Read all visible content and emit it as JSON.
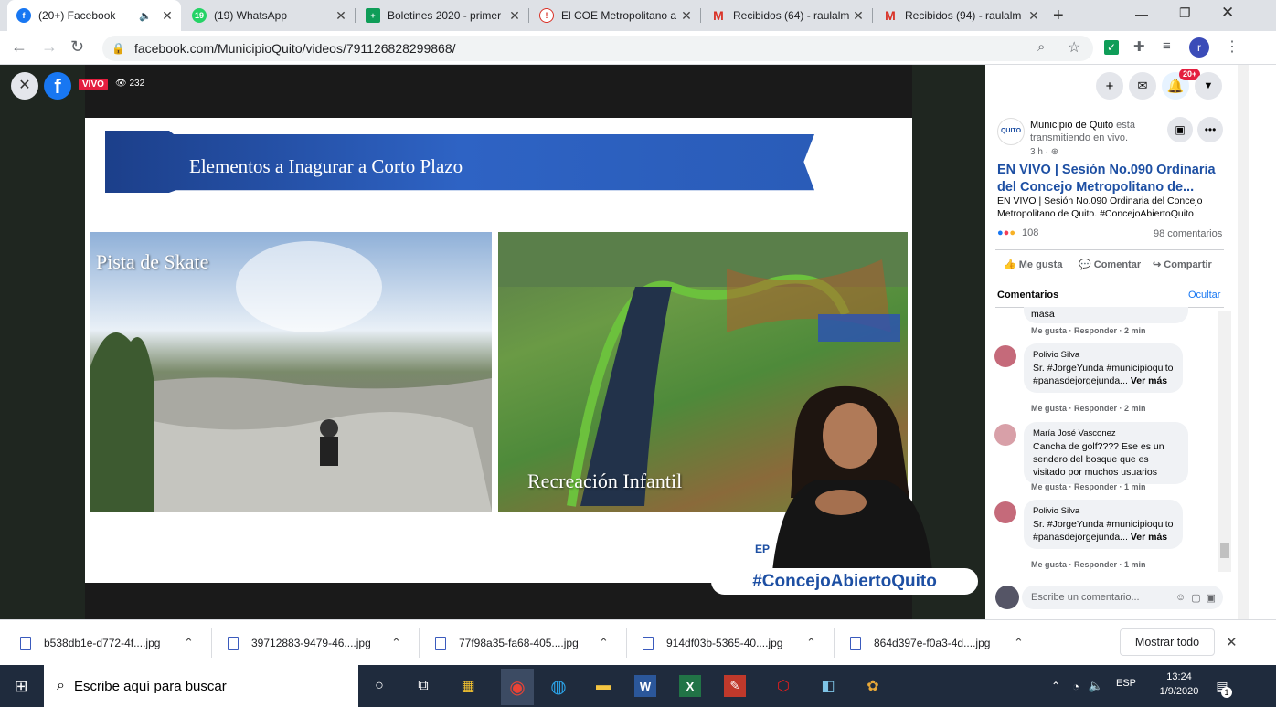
{
  "tabs": [
    {
      "title": "(20+) Facebook",
      "active": true
    },
    {
      "title": "(19) WhatsApp",
      "badge": "19"
    },
    {
      "title": "Boletines 2020 - primer"
    },
    {
      "title": "El COE Metropolitano a"
    },
    {
      "title": "Recibidos (64) - raulalm"
    },
    {
      "title": "Recibidos (94) - raulalm"
    }
  ],
  "address": {
    "url": "facebook.com/MunicipioQuito/videos/791126828299868/"
  },
  "video": {
    "live_label": "VIVO",
    "viewers": "232",
    "slide_title": "Elementos a Inagurar a Corto Plazo",
    "caption_left": "Pista de Skate",
    "caption_right": "Recreación Infantil",
    "hashtag": "#ConcejoAbiertoQuito",
    "corner_logo": "EP"
  },
  "panel": {
    "notif_badge": "20+",
    "page_logo": "QUITO",
    "page_name": "Municipio de Quito",
    "status_text": " está transmitiendo en vivo.",
    "time": "3 h",
    "post_title": "EN VIVO | Sesión No.090 Ordinaria del Concejo Metropolitano de...",
    "post_desc": "EN VIVO | Sesión No.090 Ordinaria del Concejo Metropolitano de Quito. #ConcejoAbiertoQuito",
    "reactions": "108",
    "comments_count": "98 comentarios",
    "like": "Me gusta",
    "comment": "Comentar",
    "share": "Compartir",
    "comments_header": "Comentarios",
    "hide": "Ocultar",
    "comments": [
      {
        "name": "",
        "text": "masa",
        "meta": "Me gusta · Responder · 2 min"
      },
      {
        "name": "Polivio Silva",
        "text": "Sr. #JorgeYunda #municipioquito #panasdejorgejunda...",
        "more": "Ver más",
        "meta": "Me gusta · Responder · 2 min"
      },
      {
        "name": "María José Vasconez",
        "text": "Cancha de golf???? Ese es un sendero del bosque que es visitado por muchos usuarios",
        "meta": "Me gusta · Responder · 1 min"
      },
      {
        "name": "Polivio Silva",
        "text": "Sr. #JorgeYunda #municipioquito #panasdejorgejunda...",
        "more": "Ver más",
        "meta": "Me gusta · Responder · 1 min"
      }
    ],
    "write_placeholder": "Escribe un comentario..."
  },
  "downloads": {
    "files": [
      "b538db1e-d772-4f....jpg",
      "39712883-9479-46....jpg",
      "77f98a35-fa68-405....jpg",
      "914df03b-5365-40....jpg",
      "864d397e-f0a3-4d....jpg"
    ],
    "show_all": "Mostrar todo"
  },
  "taskbar": {
    "search_placeholder": "Escribe aquí para buscar",
    "lang": "ESP",
    "time": "13:24",
    "date": "1/9/2020",
    "notif_count": "1"
  }
}
